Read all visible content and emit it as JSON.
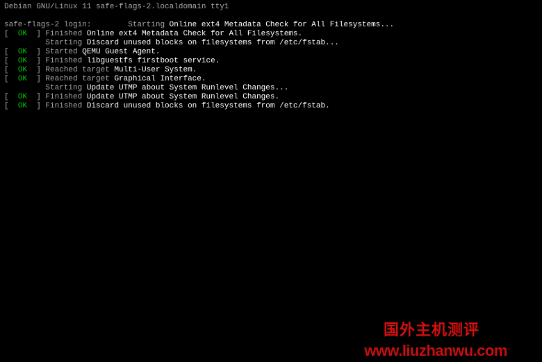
{
  "header": "Debian GNU/Linux 11 safe-flags-2.localdomain tty1",
  "login_prompt": "safe-flags-2 login: ",
  "lines": [
    {
      "status": null,
      "action": "Starting",
      "message": "Online ext4 Metadata Check for All Filesystems..."
    },
    {
      "status": "OK",
      "action": "Finished",
      "message": "Online ext4 Metadata Check for All Filesystems."
    },
    {
      "status": null,
      "action": "Starting",
      "message": "Discard unused blocks on filesystems from /etc/fstab..."
    },
    {
      "status": "OK",
      "action": "Started",
      "message": "QEMU Guest Agent."
    },
    {
      "status": "OK",
      "action": "Finished",
      "message": "libguestfs firstboot service."
    },
    {
      "status": "OK",
      "action": "Reached target",
      "message": "Multi-User System."
    },
    {
      "status": "OK",
      "action": "Reached target",
      "message": "Graphical Interface."
    },
    {
      "status": null,
      "action": "Starting",
      "message": "Update UTMP about System Runlevel Changes..."
    },
    {
      "status": "OK",
      "action": "Finished",
      "message": "Update UTMP about System Runlevel Changes."
    },
    {
      "status": "OK",
      "action": "Finished",
      "message": "Discard unused blocks on filesystems from /etc/fstab."
    }
  ],
  "watermark_cn": "国外主机测评",
  "watermark_url": "www.liuzhanwu.com",
  "bracket_open": "[  ",
  "bracket_close": "  ] ",
  "indent": "         "
}
